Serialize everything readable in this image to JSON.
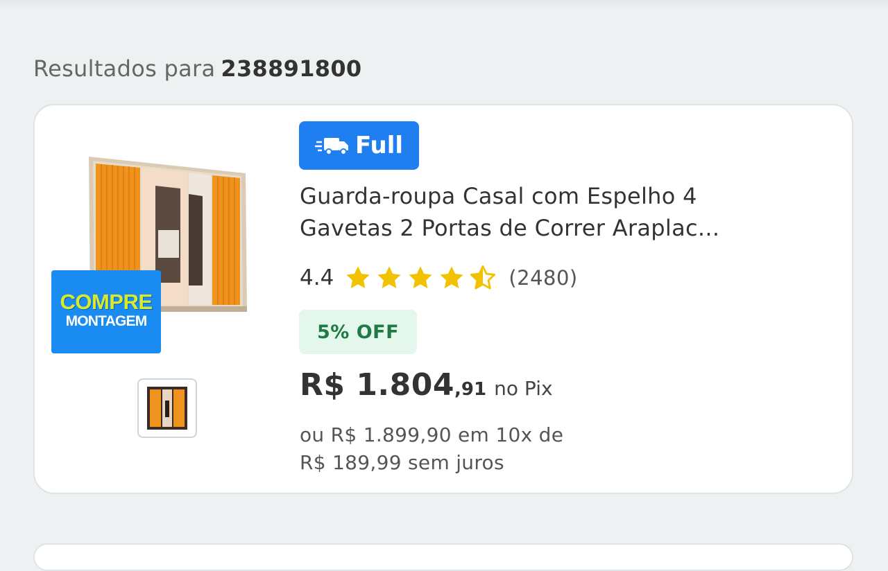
{
  "search": {
    "results_label": "Resultados para",
    "query": "238891800"
  },
  "product": {
    "shipping_badge": "Full",
    "assembly_badge_line1": "COMPRE",
    "assembly_badge_line2": "MONTAGEM",
    "title_line1": "Guarda-roupa Casal com Espelho 4",
    "title_line2": "Gavetas 2 Portas de Correr Araplac...",
    "rating": "4.4",
    "rating_fraction": 0.88,
    "review_count": "(2480)",
    "discount": "5% OFF",
    "price_main": "R$ 1.804",
    "price_cents": ",91",
    "price_method": "no Pix",
    "installments_line1": "ou R$ 1.899,90 em 10x de",
    "installments_line2": "R$ 189,99 sem juros"
  },
  "icons": {
    "shipping": "truck-icon",
    "star": "star-icon"
  },
  "colors": {
    "full_badge": "#1f7ff0",
    "star": "#f2c200",
    "discount_bg": "#e3f7ec",
    "discount_text": "#1f7a45",
    "assembly_badge": "#1a8bf0"
  }
}
